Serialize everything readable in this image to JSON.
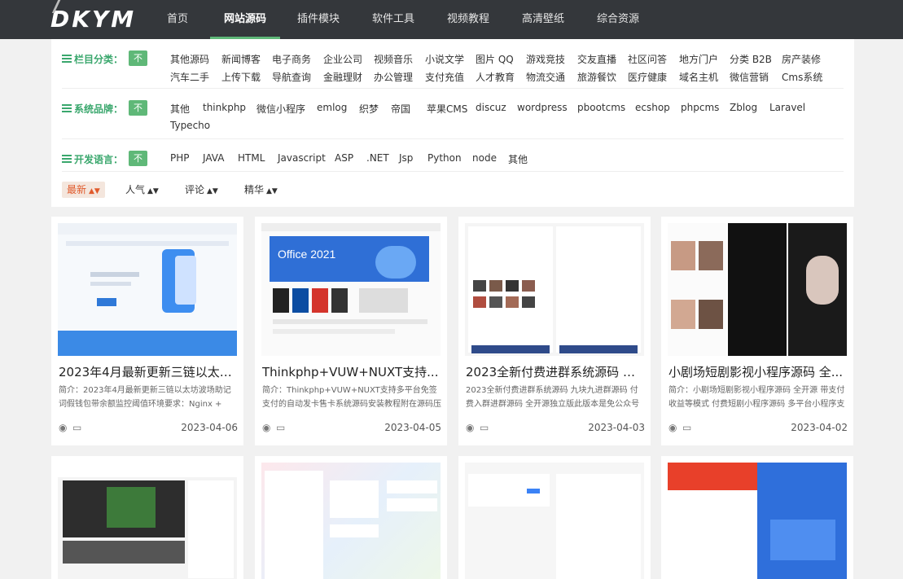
{
  "logo": "DKYM",
  "nav": [
    {
      "label": "首页"
    },
    {
      "label": "网站源码",
      "active": true
    },
    {
      "label": "插件模块"
    },
    {
      "label": "软件工具"
    },
    {
      "label": "视频教程"
    },
    {
      "label": "高清壁纸"
    },
    {
      "label": "综合资源"
    }
  ],
  "filters": {
    "unlimited": "不限",
    "category": {
      "label": "栏目分类：",
      "options_row1": [
        "其他源码",
        "新闻博客",
        "电子商务",
        "企业公司",
        "视频音乐",
        "小说文学",
        "图片 QQ",
        "游戏竞技",
        "交友直播",
        "社区问答",
        "地方门户",
        "分类 B2B",
        "房产装修"
      ],
      "options_row2": [
        "汽车二手",
        "上传下载",
        "导航查询",
        "金融理财",
        "办公管理",
        "支付充值",
        "人才教育",
        "物流交通",
        "旅游餐饮",
        "医疗健康",
        "域名主机",
        "微信营销",
        "Cms系统"
      ]
    },
    "brand": {
      "label": "系统品牌：",
      "options_row1": [
        "其他",
        "thinkphp",
        "微信小程序",
        "emlog",
        "织梦",
        "帝国",
        "苹果CMS",
        "discuz",
        "wordpress",
        "pbootcms",
        "ecshop",
        "phpcms",
        "Zblog",
        "Laravel"
      ],
      "options_row2": [
        "Typecho"
      ]
    },
    "language": {
      "label": "开发语言：",
      "options": [
        "PHP",
        "JAVA",
        "HTML",
        "Javascript",
        "ASP",
        ".NET",
        "Jsp",
        "Python",
        "node",
        "其他"
      ]
    }
  },
  "sort": [
    {
      "label": "最新",
      "active": true
    },
    {
      "label": "人气"
    },
    {
      "label": "评论"
    },
    {
      "label": "精华"
    }
  ],
  "icons": {
    "view": "eye-icon",
    "comment": "comment-icon",
    "sort": "sort-caret-icon",
    "list": "list-icon"
  },
  "colors": {
    "accent": "#5fb878",
    "nav_bg": "#34373b",
    "sort_active": "#e05a2c"
  },
  "cards": [
    {
      "title": "2023年4月最新更新三链以太坊...",
      "summary": "简介：2023年4月最新更新三链以太坊波场助记词假钱包带余额监控阈值环境要求：Nginx +",
      "date": "2023-04-06"
    },
    {
      "title": "Thinkphp+VUW+NUXT支持...",
      "summary": "简介：Thinkphp+VUW+NUXT支持多平台免签支付的自动发卡售卡系统源码安装教程附在源码压缩",
      "date": "2023-04-05",
      "thumb_text": "Office 2021"
    },
    {
      "title": "2023全新付费进群系统源码 九...",
      "summary": "2023全新付费进群系统源码 九块九进群源码 付费入群进群源码 全开源独立版此版本是免公众号的版",
      "date": "2023-04-03"
    },
    {
      "title": "小剧场短剧影视小程序源码 全...",
      "summary": "简介：小剧场短剧影视小程序源码 全开源 带支付收益等模式 付费短剧小程序源码 多平台小程序支",
      "date": "2023-04-02"
    }
  ],
  "cards_row2_count": 4
}
